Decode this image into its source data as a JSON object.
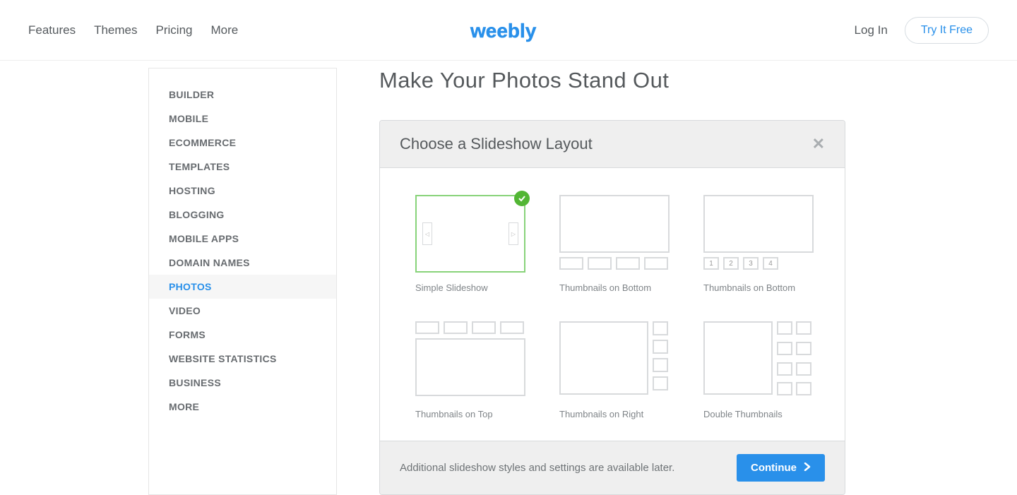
{
  "header": {
    "nav": [
      "Features",
      "Themes",
      "Pricing",
      "More"
    ],
    "logo_text": "weebly",
    "login": "Log In",
    "try_free": "Try It Free"
  },
  "sidebar": {
    "items": [
      "BUILDER",
      "MOBILE",
      "ECOMMERCE",
      "TEMPLATES",
      "HOSTING",
      "BLOGGING",
      "MOBILE APPS",
      "DOMAIN NAMES",
      "PHOTOS",
      "VIDEO",
      "FORMS",
      "WEBSITE STATISTICS",
      "BUSINESS",
      "MORE"
    ],
    "active": "PHOTOS"
  },
  "page": {
    "title": "Make Your Photos Stand Out"
  },
  "modal": {
    "title": "Choose a Slideshow Layout",
    "layouts": [
      {
        "label": "Simple Slideshow"
      },
      {
        "label": "Thumbnails on Bottom"
      },
      {
        "label": "Thumbnails on Bottom"
      },
      {
        "label": "Thumbnails on Top"
      },
      {
        "label": "Thumbnails on Right"
      },
      {
        "label": "Double Thumbnails"
      }
    ],
    "numbers": [
      "1",
      "2",
      "3",
      "4"
    ],
    "footer_text": "Additional slideshow styles and settings are available later.",
    "continue": "Continue"
  }
}
